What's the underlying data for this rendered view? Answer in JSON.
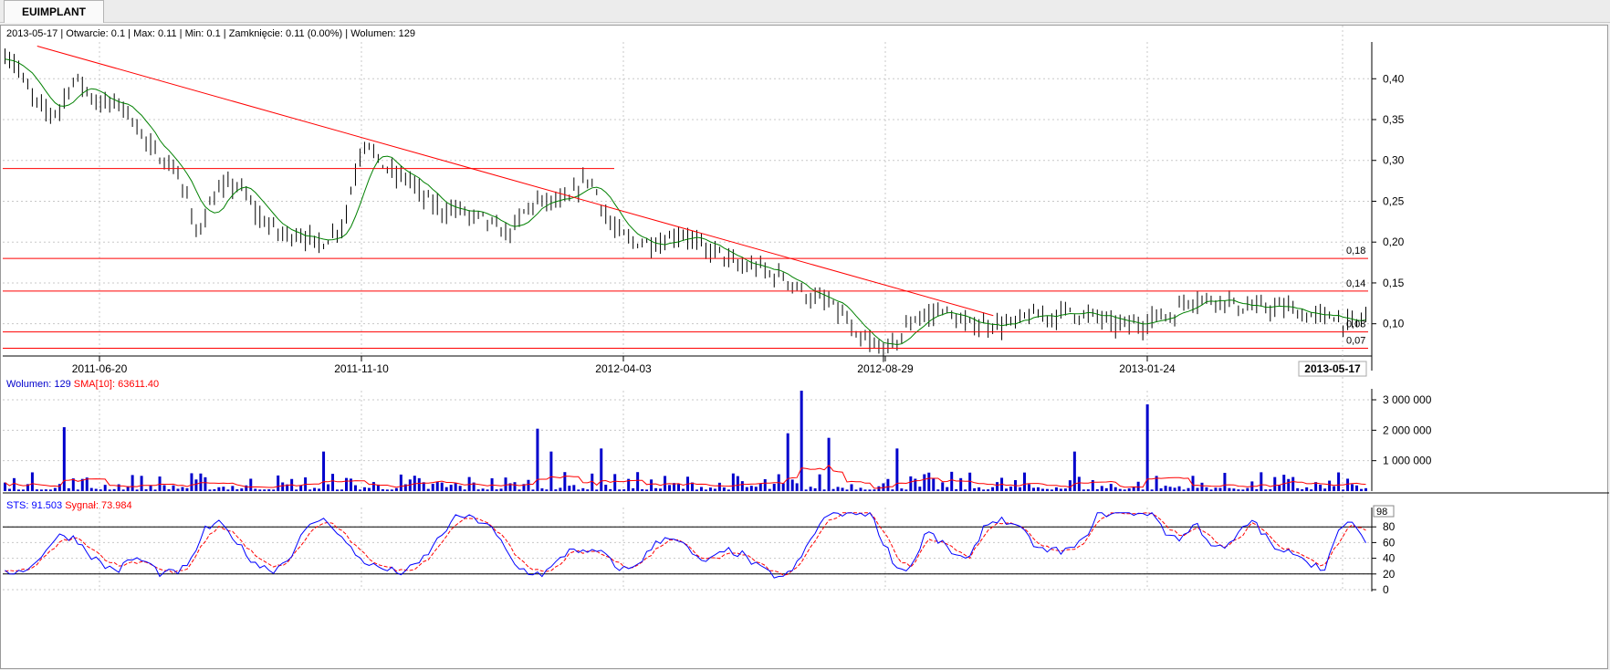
{
  "tab": {
    "label": "EUIMPLANT"
  },
  "info": {
    "date": "2013-05-17",
    "open_label": "Otwarcie:",
    "open": "0.1",
    "max_label": "Max:",
    "max": "0.11",
    "min_label": "Min:",
    "min": "0.1",
    "close_label": "Zamknięcie:",
    "close": "0.11 (0.00%)",
    "volume_label": "Wolumen:",
    "volume": "129"
  },
  "volume_legend": {
    "label": "Wolumen: 129",
    "sma": "SMA[10]: 63611.40",
    "label_color": "#0000cc",
    "sma_color": "#ff0000"
  },
  "sts_legend": {
    "sts": "STS: 91.503",
    "signal": "Sygnał: 73.984",
    "sts_color": "#0000ff",
    "signal_color": "#ff0000"
  },
  "chart_data": [
    {
      "type": "ohlc",
      "y_ticks": [
        "0,40",
        "0,35",
        "0,30",
        "0,25",
        "0,20",
        "0,15",
        "0,10"
      ],
      "y_tick_values": [
        0.4,
        0.35,
        0.3,
        0.25,
        0.2,
        0.15,
        0.1
      ],
      "x_ticks": [
        "2011-06-20",
        "2011-11-10",
        "2012-04-03",
        "2012-08-29",
        "2013-01-24"
      ],
      "x_current": "2013-05-17",
      "ylim": [
        0.065,
        0.445
      ],
      "hlines": [
        {
          "value": 0.29,
          "label": ""
        },
        {
          "value": 0.18,
          "label": "0,18"
        },
        {
          "value": 0.14,
          "label": "0,14"
        },
        {
          "value": 0.09,
          "label": "0,08"
        },
        {
          "value": 0.07,
          "label": "0,07"
        }
      ],
      "trendline": {
        "from": [
          "2011-05-17",
          0.44
        ],
        "to": [
          "2012-10-29",
          0.11
        ]
      },
      "close_series": [
        0.43,
        0.42,
        0.39,
        0.37,
        0.36,
        0.36,
        0.39,
        0.4,
        0.38,
        0.37,
        0.37,
        0.37,
        0.35,
        0.33,
        0.31,
        0.3,
        0.29,
        0.26,
        0.21,
        0.24,
        0.26,
        0.27,
        0.27,
        0.25,
        0.23,
        0.22,
        0.21,
        0.21,
        0.21,
        0.2,
        0.2,
        0.21,
        0.23,
        0.29,
        0.33,
        0.3,
        0.29,
        0.28,
        0.28,
        0.26,
        0.25,
        0.24,
        0.24,
        0.24,
        0.23,
        0.23,
        0.22,
        0.21,
        0.22,
        0.24,
        0.25,
        0.25,
        0.25,
        0.25,
        0.27,
        0.28,
        0.25,
        0.22,
        0.21,
        0.2,
        0.2,
        0.2,
        0.2,
        0.21,
        0.21,
        0.2,
        0.19,
        0.19,
        0.18,
        0.17,
        0.17,
        0.17,
        0.16,
        0.16,
        0.15,
        0.14,
        0.13,
        0.13,
        0.12,
        0.11,
        0.08,
        0.08,
        0.07,
        0.07,
        0.08,
        0.1,
        0.11,
        0.11,
        0.12,
        0.11,
        0.1,
        0.1,
        0.1,
        0.1,
        0.1,
        0.1,
        0.11,
        0.11,
        0.11,
        0.11,
        0.12,
        0.11,
        0.11,
        0.11,
        0.1,
        0.1,
        0.1,
        0.1,
        0.11,
        0.11,
        0.11,
        0.13,
        0.13,
        0.13,
        0.13,
        0.13,
        0.12,
        0.12,
        0.12,
        0.12,
        0.12,
        0.12,
        0.11,
        0.11,
        0.11,
        0.11,
        0.1,
        0.1,
        0.11
      ]
    },
    {
      "type": "bar",
      "title": "Wolumen",
      "y_ticks": [
        "3 000 000",
        "2 000 000",
        "1 000 000"
      ],
      "y_tick_values": [
        3000000,
        2000000,
        1000000
      ],
      "ylim": [
        0,
        3300000
      ],
      "spikes": [
        [
          "2011-05-31",
          2100000
        ],
        [
          "2011-10-19",
          1300000
        ],
        [
          "2012-02-14",
          2050000
        ],
        [
          "2012-02-22",
          1300000
        ],
        [
          "2012-03-20",
          1400000
        ],
        [
          "2012-07-03",
          1900000
        ],
        [
          "2012-07-12",
          3300000
        ],
        [
          "2012-07-27",
          1750000
        ],
        [
          "2012-09-03",
          1400000
        ],
        [
          "2013-01-24",
          2850000
        ],
        [
          "2012-12-12",
          1300000
        ]
      ],
      "sma_label": "SMA[10]"
    },
    {
      "type": "line",
      "title": "STS",
      "y_ticks": [
        "80",
        "60",
        "40",
        "20",
        "0"
      ],
      "y_tick_values": [
        80,
        60,
        40,
        20,
        0
      ],
      "y_marker": "98",
      "ylim": [
        0,
        100
      ],
      "hlines": [
        80,
        20
      ],
      "series": [
        {
          "name": "STS",
          "values": [
            20,
            25,
            30,
            55,
            70,
            65,
            45,
            30,
            25,
            40,
            35,
            20,
            22,
            30,
            75,
            85,
            70,
            45,
            30,
            25,
            40,
            70,
            90,
            85,
            60,
            40,
            30,
            25,
            22,
            30,
            50,
            75,
            95,
            90,
            85,
            60,
            30,
            22,
            20,
            35,
            55,
            45,
            50,
            30,
            25,
            40,
            60,
            70,
            55,
            35,
            40,
            50,
            45,
            30,
            20,
            15,
            35,
            70,
            95,
            98,
            98,
            98,
            60,
            25,
            30,
            75,
            60,
            45,
            35,
            80,
            90,
            85,
            70,
            50,
            50,
            50,
            60,
            95,
            98,
            98,
            98,
            98,
            70,
            65,
            85,
            60,
            50,
            70,
            90,
            65,
            45,
            50,
            35,
            25,
            70,
            90,
            55
          ]
        },
        {
          "name": "Sygnał",
          "values": [
            22,
            24,
            28,
            45,
            62,
            66,
            55,
            40,
            30,
            35,
            36,
            25,
            22,
            27,
            60,
            80,
            75,
            55,
            38,
            28,
            35,
            60,
            82,
            86,
            70,
            50,
            36,
            28,
            24,
            28,
            42,
            65,
            88,
            90,
            87,
            70,
            45,
            28,
            22,
            30,
            48,
            48,
            48,
            36,
            28,
            35,
            52,
            65,
            60,
            42,
            38,
            46,
            46,
            36,
            25,
            18,
            28,
            58,
            88,
            96,
            98,
            98,
            75,
            38,
            28,
            62,
            64,
            52,
            40,
            68,
            86,
            86,
            76,
            58,
            52,
            50,
            56,
            86,
            96,
            98,
            98,
            98,
            80,
            68,
            80,
            68,
            55,
            64,
            84,
            72,
            52,
            50,
            40,
            30,
            58,
            84,
            74
          ]
        }
      ]
    }
  ]
}
